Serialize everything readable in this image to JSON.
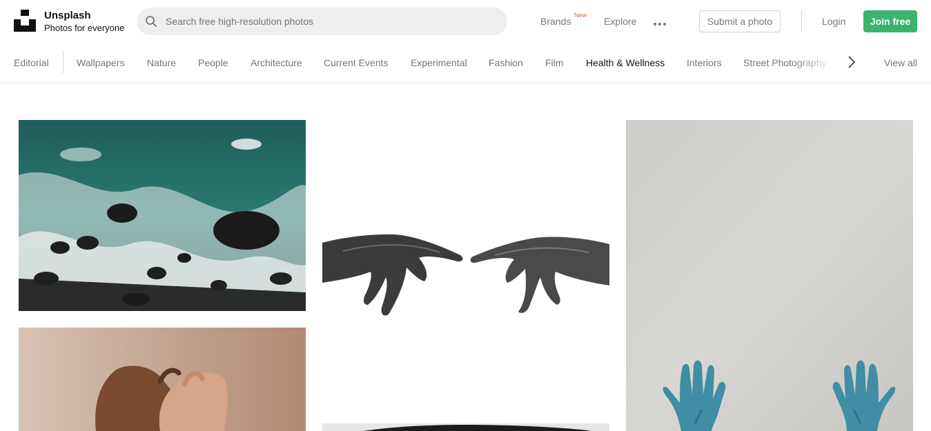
{
  "brand": {
    "name": "Unsplash",
    "tagline": "Photos for everyone"
  },
  "search": {
    "placeholder": "Search free high-resolution photos",
    "value": ""
  },
  "header_nav": {
    "brands": "Brands",
    "brands_badge": "New",
    "explore": "Explore",
    "more_icon": "more-horizontal-icon",
    "submit": "Submit a photo",
    "login": "Login",
    "join": "Join free"
  },
  "categories": {
    "editorial": "Editorial",
    "items": [
      "Wallpapers",
      "Nature",
      "People",
      "Architecture",
      "Current Events",
      "Experimental",
      "Fashion",
      "Film",
      "Health & Wellness",
      "Interiors",
      "Street Photography"
    ],
    "active": "Health & Wellness",
    "view_all": "View all",
    "scroll_icon": "chevron-right-icon"
  },
  "colors": {
    "accent_green": "#3cb46e",
    "new_badge": "#e25c3d",
    "muted_text": "#767676",
    "search_bg": "#eeeeee"
  },
  "photos": [
    {
      "subject": "ocean-waves-rocks"
    },
    {
      "subject": "reaching-hands"
    },
    {
      "subject": "blue-gloved-hands"
    },
    {
      "subject": "pinky-promise"
    },
    {
      "subject": "black-and-white-partial"
    }
  ]
}
